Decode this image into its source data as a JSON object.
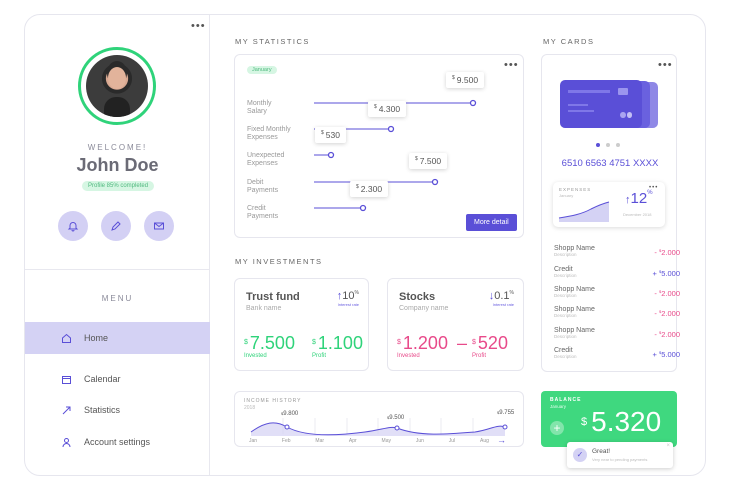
{
  "profile": {
    "welcome": "WELCOME!",
    "name": "John Doe",
    "completion": "Profile 85% completed"
  },
  "menu": {
    "title": "MENU",
    "items": [
      {
        "label": "Home",
        "icon": "home-icon"
      },
      {
        "label": "Calendar",
        "icon": "calendar-icon"
      },
      {
        "label": "Statistics",
        "icon": "statistics-icon"
      },
      {
        "label": "Account settings",
        "icon": "user-icon"
      }
    ]
  },
  "statistics": {
    "title": "MY STATISTICS",
    "month": "January",
    "rows": [
      {
        "label1": "Monthly",
        "label2": "Salary",
        "value": "9.500",
        "currency": "$",
        "amount": 9500
      },
      {
        "label1": "Fixed Monthly",
        "label2": "Expenses",
        "value": "4.300",
        "currency": "$",
        "amount": 4300
      },
      {
        "label1": "Unexpected",
        "label2": "Expenses",
        "value": "530",
        "currency": "$",
        "amount": 530
      },
      {
        "label1": "Debit",
        "label2": "Payments",
        "value": "7.500",
        "currency": "$",
        "amount": 7500
      },
      {
        "label1": "Credit",
        "label2": "Payments",
        "value": "2.300",
        "currency": "$",
        "amount": 2300
      }
    ],
    "more_button": "More detail"
  },
  "investments": {
    "title": "MY INVESTMENTS",
    "items": [
      {
        "name": "Trust fund",
        "sub": "Bank name",
        "rate": "10",
        "rate_unit": "%",
        "rate_label": "Interest rate",
        "direction": "up",
        "invested": "7.500",
        "profit": "1.100",
        "invested_label": "Invested",
        "profit_label": "Profit",
        "sign": ""
      },
      {
        "name": "Stocks",
        "sub": "Company name",
        "rate": "0.1",
        "rate_unit": "%",
        "rate_label": "Interest rate",
        "direction": "down",
        "invested": "1.200",
        "profit": "520",
        "invested_label": "Invested",
        "profit_label": "Profit",
        "sign": "–"
      }
    ],
    "currency": "$"
  },
  "income": {
    "title": "INCOME HISTORY",
    "year": "2018",
    "months": [
      "Jan",
      "Feb",
      "Mar",
      "Apr",
      "May",
      "Jun",
      "Jul",
      "Aug"
    ],
    "peaks": [
      {
        "value": "9.800",
        "month": "Feb"
      },
      {
        "value": "9.500",
        "month": "Jun"
      },
      {
        "value": "9.755",
        "month": "Sep"
      }
    ],
    "currency": "$"
  },
  "cards": {
    "title": "MY CARDS",
    "number": "6510 6563 4751 XXXX",
    "expenses": {
      "label": "EXPENSES",
      "month": "January",
      "percent": "12",
      "unit": "%",
      "note": "December 2018"
    },
    "transactions": [
      {
        "name": "Shopp Name",
        "desc": "Description",
        "sign": "-",
        "amount": "2.000",
        "type": "out"
      },
      {
        "name": "Credit",
        "desc": "Description",
        "sign": "+",
        "amount": "5.000",
        "type": "in"
      },
      {
        "name": "Shopp Name",
        "desc": "Description",
        "sign": "-",
        "amount": "2.000",
        "type": "out"
      },
      {
        "name": "Shopp Name",
        "desc": "Description",
        "sign": "-",
        "amount": "2.000",
        "type": "out"
      },
      {
        "name": "Shopp Name",
        "desc": "Description",
        "sign": "-",
        "amount": "2.000",
        "type": "out"
      },
      {
        "name": "Credit",
        "desc": "Description",
        "sign": "+",
        "amount": "5.000",
        "type": "in"
      }
    ],
    "currency": "$"
  },
  "balance": {
    "label": "BALANCE",
    "month": "January",
    "amount": "5.320",
    "currency": "$"
  },
  "toast": {
    "title": "Great!",
    "message": "Very near to pending payments"
  },
  "colors": {
    "accent": "#5a4fd7",
    "green": "#2fd37a",
    "pink": "#e84a8a",
    "lavender": "#d4d2f4"
  }
}
